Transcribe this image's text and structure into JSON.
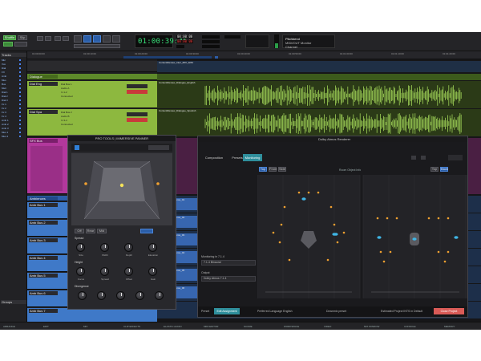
{
  "toolbar": {
    "mode_buttons": [
      "Shuffle",
      "Slip"
    ],
    "counter_main": "01:00:39:45",
    "counter_sub_a": "00:00:00",
    "counter_sub_b": "00:00:00",
    "pitch_panel_title": "Pitchbend",
    "pitch_panel_line1": "MIDI/OUT Monitor",
    "pitch_panel_line2": "Channel"
  },
  "ruler": {
    "ticks": [
      "01:00:00:00",
      "01:00:10:00",
      "01:00:20:00",
      "01:00:30:00",
      "01:00:40:00",
      "01:00:50:00",
      "01:01:00:00",
      "01:01:10:00",
      "01:01:20:00"
    ]
  },
  "left_browser": {
    "head_tracks": "Tracks",
    "head_groups": "Groups",
    "rows": [
      "Mkr",
      "Vox",
      "Dial",
      "FX",
      "Amb",
      "Mus",
      "Bus",
      "Mstr",
      "Dial 1",
      "Dial 2",
      "Dial 3",
      "Fx 1",
      "Fx 2",
      "Fx 3",
      "Fx 4",
      "Amb 1",
      "Amb 2",
      "Amb 3",
      "Mus 1",
      "Mus 2"
    ]
  },
  "tracks": {
    "header_name": "Dialogue",
    "track1_name": "Dial Eng",
    "track1_text": [
      "Dial Bus 1",
      "Audio A",
      "In 1-2",
      "Connected"
    ],
    "track2_name": "Dial Spa",
    "track2_text": [
      "Dial Bus 2",
      "Audio B",
      "In 3-4",
      "Connected"
    ],
    "magenta_name": "SFX Bus",
    "blue_header": "Ambiences",
    "blue_tracks": [
      "Amb Bus 1",
      "Amb Bus 2",
      "Amb Bus 3",
      "Amb Bus 4",
      "Amb Bus 5",
      "Amb Bus 6",
      "Amb Bus 7"
    ]
  },
  "timeline": {
    "clip1": "ContentReview_Inter_MIX_WAV",
    "clip2": "ContentReview_Dialogue_English",
    "clip3": "ContentReview_Dialogue_Spanish",
    "amb_clips": [
      "Amb_Ambience_01",
      "Amb_Ambience_02",
      "Amb_Ambience_03",
      "Amb_Ambience_04",
      "Amb_Ambience_05",
      "Amb_Ambience_06"
    ]
  },
  "plugin": {
    "title": "PRO TOOLS | IMMERSIVE PANNER",
    "tabs": [
      "Off",
      "Rear",
      "Mid"
    ],
    "section1": "Spread",
    "section2": "Height",
    "section3": "Divergence",
    "knob_labels": [
      "Size",
      "Width",
      "Depth",
      "Elevation",
      "Focus",
      "Spread",
      "Offset",
      "Gain"
    ]
  },
  "spatial": {
    "title": "Dolby Atmos Renderer",
    "tabs": [
      "Composition",
      "Presets",
      "Monitoring"
    ],
    "sub_tabs": [
      "Top",
      "Front",
      "Side"
    ],
    "view_label": "Room Object Info",
    "right_tabs": [
      "Top",
      "Back"
    ],
    "field1_label": "Monitoring in 7.1.4",
    "field1": "7.1.4 Binaural",
    "field2_label": "Output",
    "field2": "Dolby Atmos 7.1.4",
    "footer_left": "Preset",
    "footer_btn": "Edit Assignment",
    "footer_mid": "Preferred Language English",
    "footer_mid2": "Downmix preset",
    "footer_right": "Estimated Project INTS in Default",
    "close_btn": "Close Project",
    "accent": "#2f8f9c",
    "close_color": "#d95b57"
  },
  "status": {
    "items": [
      "ARRANGE",
      "EDIT",
      "MIX",
      "CLIP EFFECTS",
      "ELASTIC AUDIO",
      "MIDI EDITOR",
      "SCORE",
      "WORKSPACE",
      "VIDEO",
      "MIX WINDOW",
      "CONSOLE",
      "MEMORY"
    ]
  }
}
